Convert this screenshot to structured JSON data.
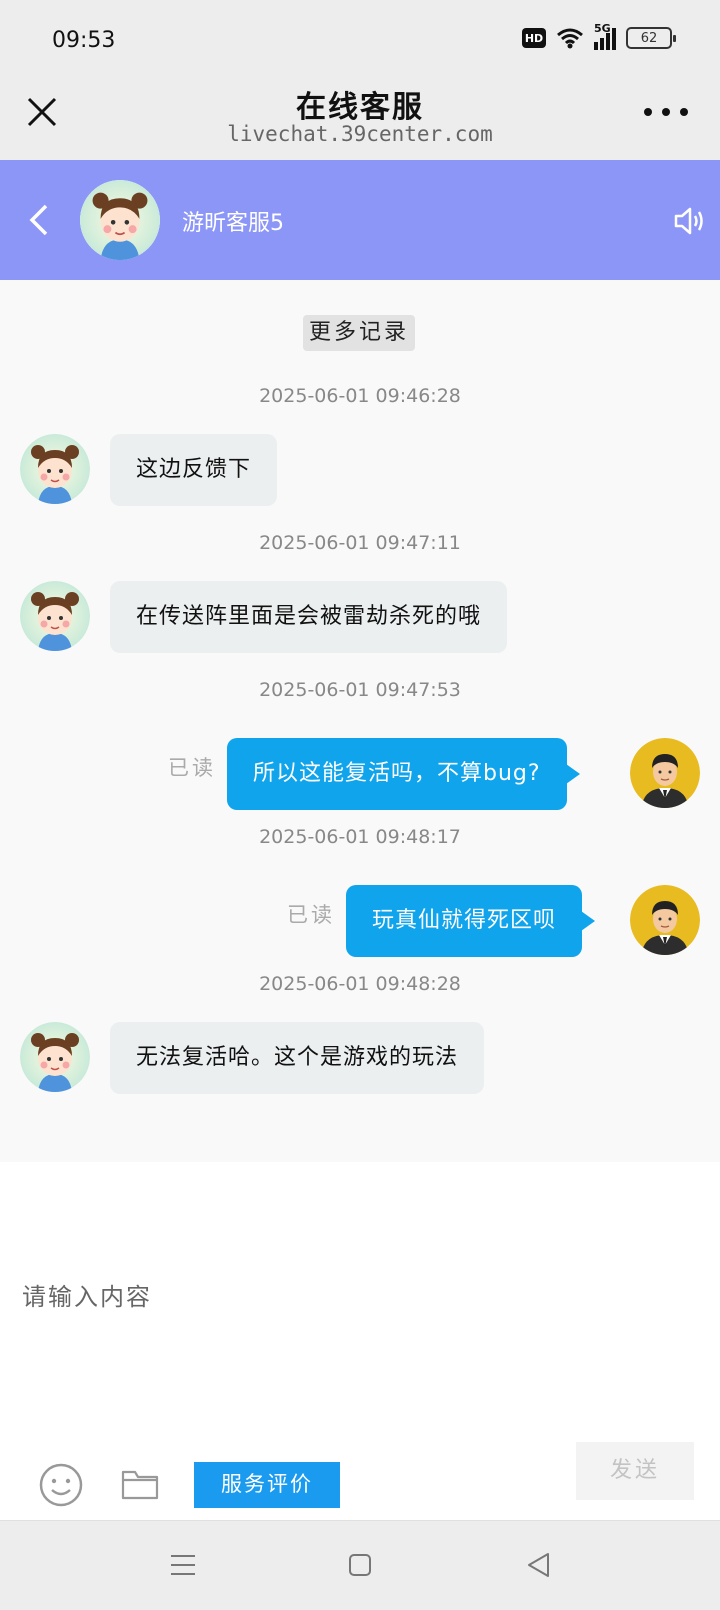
{
  "status_bar": {
    "time": "09:53",
    "hd_badge": "HD",
    "network": "5G",
    "battery": "62"
  },
  "title_bar": {
    "title": "在线客服",
    "url": "livechat.39center.com"
  },
  "chat_header": {
    "agent_name": "游昕客服5"
  },
  "chat": {
    "more_history": "更多记录",
    "messages": [
      {
        "time": "2025-06-01 09:46:28",
        "sender": "agent",
        "text": "这边反馈下"
      },
      {
        "time": "2025-06-01 09:47:11",
        "sender": "agent",
        "text": "在传送阵里面是会被雷劫杀死的哦"
      },
      {
        "time": "2025-06-01 09:47:53",
        "sender": "user",
        "text": "所以这能复活吗，不算bug?",
        "status": "已读"
      },
      {
        "time": "2025-06-01 09:48:17",
        "sender": "user",
        "text": "玩真仙就得死区呗",
        "status": "已读"
      },
      {
        "time": "2025-06-01 09:48:28",
        "sender": "agent",
        "text": "无法复活哈。这个是游戏的玩法"
      }
    ]
  },
  "input": {
    "placeholder": "请输入内容",
    "value": ""
  },
  "toolbar": {
    "rate_label": "服务评价",
    "send_label": "发送",
    "emoji_icon": "emoji-icon",
    "folder_icon": "folder-icon"
  },
  "colors": {
    "header_bg": "#8c96f7",
    "user_bubble": "#10a4ec",
    "agent_bubble": "#ebeff0",
    "rate_button": "#1a9bf0"
  }
}
